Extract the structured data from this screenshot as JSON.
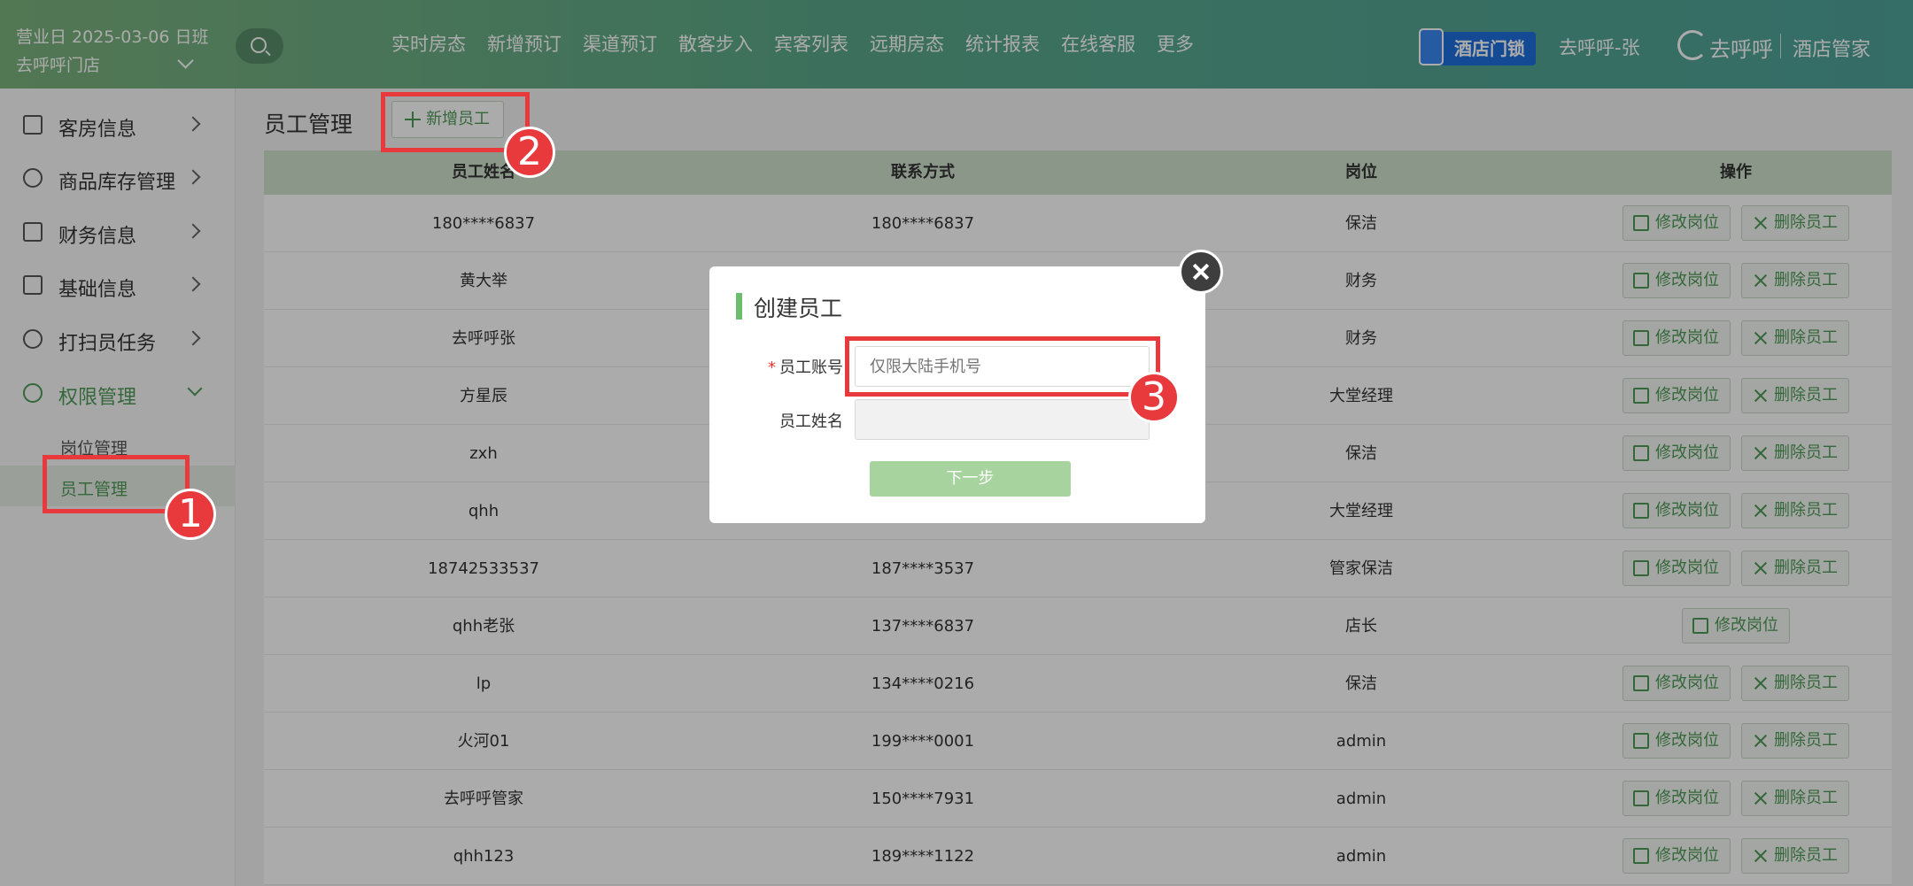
{
  "header": {
    "business_day": "营业日 2025-03-06 日班",
    "store": "去呼呼门店",
    "nav": [
      "实时房态",
      "新增预订",
      "渠道预订",
      "散客步入",
      "宾客列表",
      "远期房态",
      "统计报表",
      "在线客服",
      "更多"
    ],
    "lock_badge": "酒店门锁",
    "user": "去呼呼-张",
    "brand": "去呼呼",
    "brand_sub": "酒店管家"
  },
  "sidebar": {
    "items": [
      {
        "label": "客房信息",
        "icon": "home-icon"
      },
      {
        "label": "商品库存管理",
        "icon": "goods-icon"
      },
      {
        "label": "财务信息",
        "icon": "finance-icon"
      },
      {
        "label": "基础信息",
        "icon": "doc-icon"
      },
      {
        "label": "打扫员任务",
        "icon": "gear-icon"
      },
      {
        "label": "权限管理",
        "icon": "gear-icon"
      }
    ],
    "sub_items": [
      "岗位管理",
      "员工管理"
    ]
  },
  "main": {
    "title": "员工管理",
    "add_button": "新增员工",
    "columns": [
      "员工姓名",
      "联系方式",
      "岗位",
      "操作"
    ],
    "edit_label": "修改岗位",
    "delete_label": "删除员工",
    "rows": [
      {
        "name": "180****6837",
        "phone": "180****6837",
        "role": "保洁"
      },
      {
        "name": "黄大举",
        "phone": "",
        "role": "财务"
      },
      {
        "name": "去呼呼张",
        "phone": "",
        "role": "财务"
      },
      {
        "name": "方星辰",
        "phone": "",
        "role": "大堂经理"
      },
      {
        "name": "zxh",
        "phone": "",
        "role": "保洁"
      },
      {
        "name": "qhh",
        "phone": "",
        "role": "大堂经理"
      },
      {
        "name": "18742533537",
        "phone": "187****3537",
        "role": "管家保洁"
      },
      {
        "name": "qhh老张",
        "phone": "137****6837",
        "role": "店长"
      },
      {
        "name": "lp",
        "phone": "134****0216",
        "role": "保洁"
      },
      {
        "name": "火河01",
        "phone": "199****0001",
        "role": "admin"
      },
      {
        "name": "去呼呼管家",
        "phone": "150****7931",
        "role": "admin"
      },
      {
        "name": "qhh123",
        "phone": "189****1122",
        "role": "admin"
      }
    ]
  },
  "modal": {
    "title": "创建员工",
    "account_label": "员工账号",
    "account_placeholder": "仅限大陆手机号",
    "name_label": "员工姓名",
    "next_button": "下一步"
  },
  "annotations": [
    "1",
    "2",
    "3"
  ],
  "colors": {
    "accent": "#4e9a57",
    "highlight": "#e8393c",
    "header_start": "#7cb27d",
    "header_end": "#4fa39a"
  }
}
